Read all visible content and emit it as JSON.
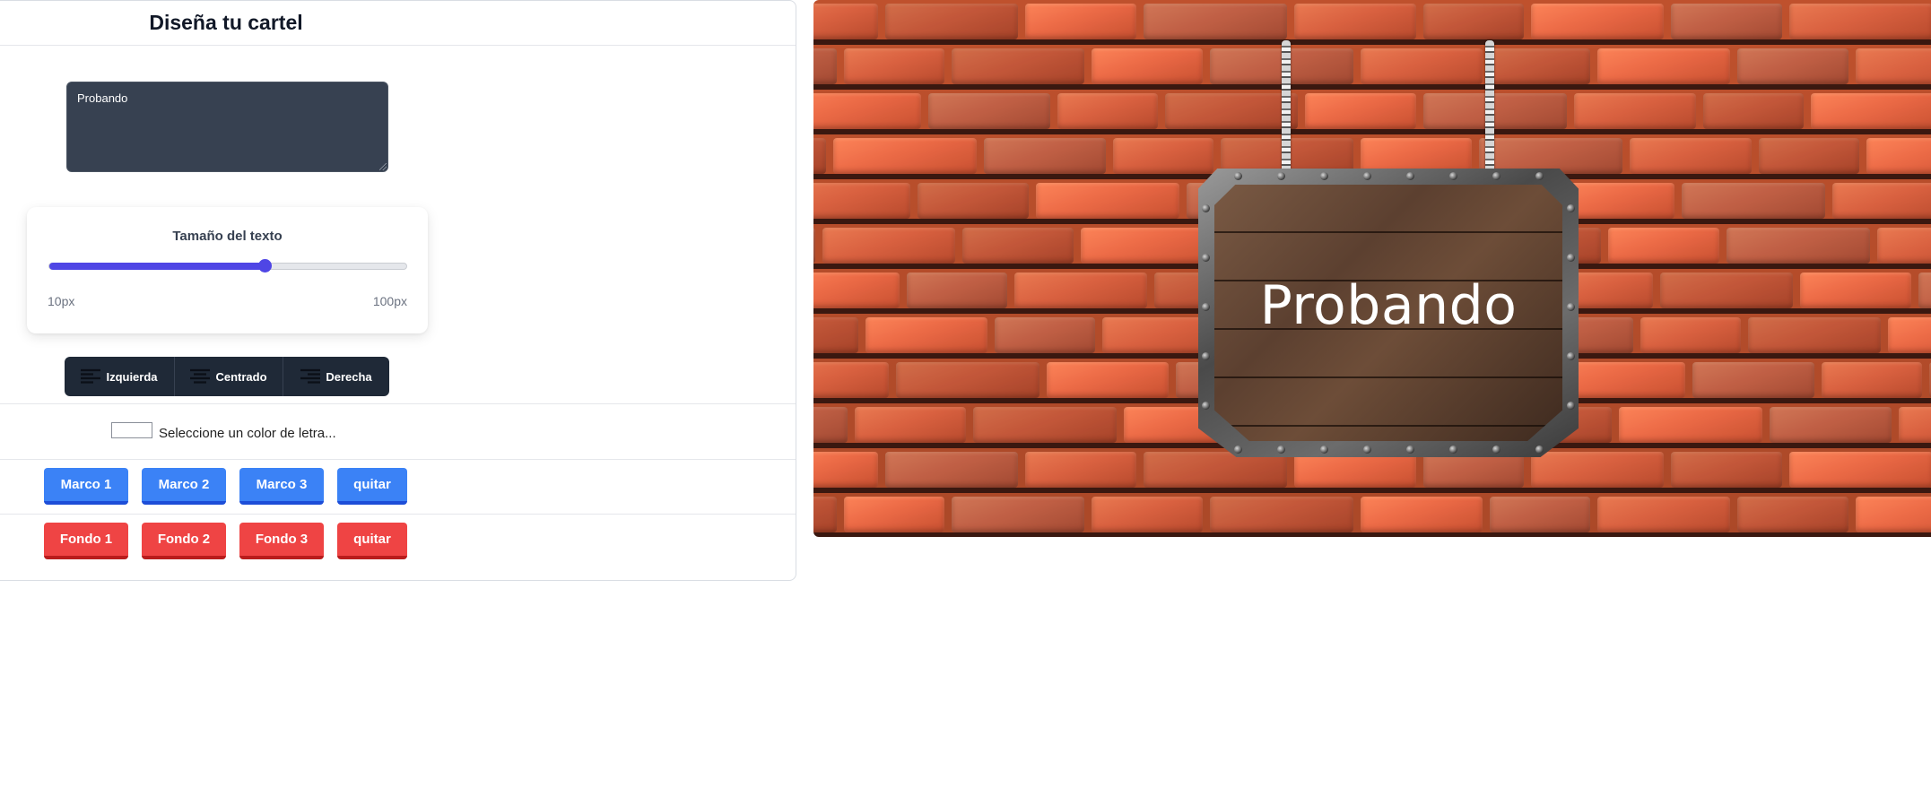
{
  "editor": {
    "title": "Diseña tu cartel",
    "textarea_value": "Probando",
    "size": {
      "label": "Tamaño del texto",
      "min_label": "10px",
      "max_label": "100px",
      "min": 10,
      "max": 100,
      "value": 64
    },
    "align_buttons": [
      {
        "label": "Izquierda",
        "icon": "align-left-icon"
      },
      {
        "label": "Centrado",
        "icon": "align-center-icon"
      },
      {
        "label": "Derecha",
        "icon": "align-right-icon"
      }
    ],
    "color_picker": {
      "label": "Seleccione un color de letra...",
      "value": "#ffffff"
    },
    "frame_buttons": [
      "Marco 1",
      "Marco 2",
      "Marco 3",
      "quitar"
    ],
    "background_buttons": [
      "Fondo 1",
      "Fondo 2",
      "Fondo 3",
      "quitar"
    ]
  },
  "preview": {
    "sign_text": "Probando",
    "text_color": "#ffffff",
    "background": "brick-wall",
    "frame": "wooden-sign-with-chains"
  },
  "colors": {
    "blue_button": "#3b82f6",
    "red_button": "#ef4444",
    "slider_accent": "#4f46e5",
    "align_group": "#1f2937",
    "textarea_bg": "#374151"
  }
}
